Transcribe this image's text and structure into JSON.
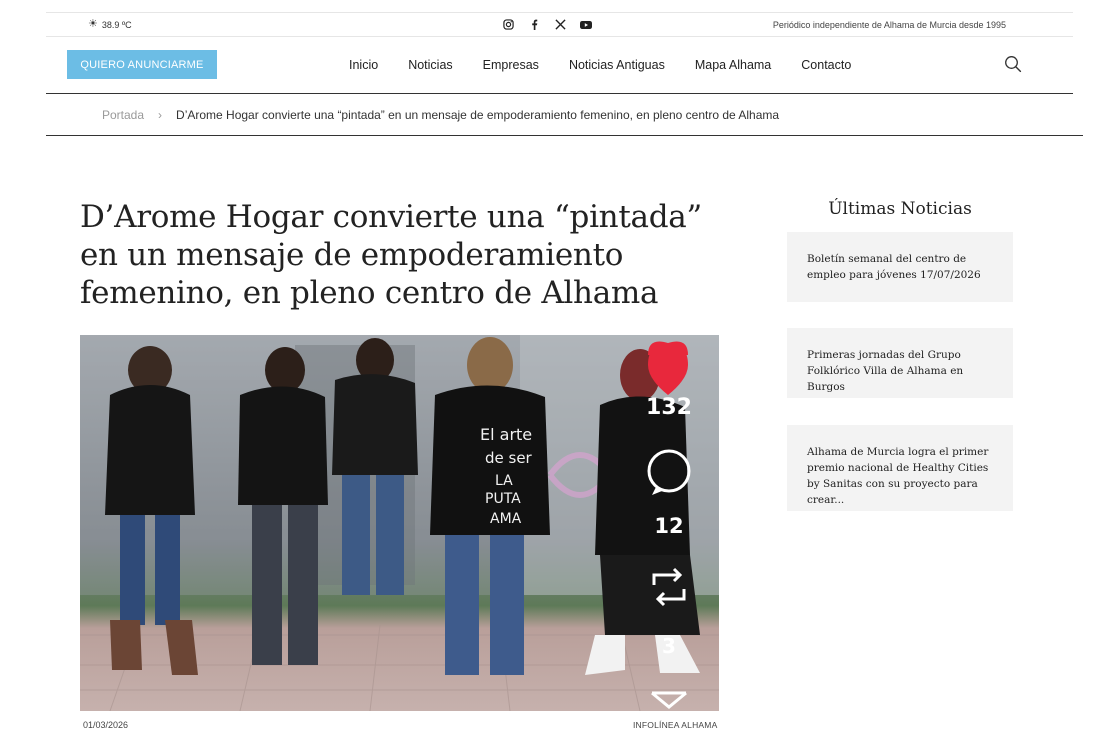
{
  "topbar": {
    "temperature": "38.9 ºC",
    "tagline": "Periódico independiente de Alhama de Murcia desde 1995",
    "social_icons": [
      "instagram-icon",
      "facebook-icon",
      "x-icon",
      "youtube-icon"
    ]
  },
  "nav": {
    "ad_button": "QUIERO ANUNCIARME",
    "items": [
      "Inicio",
      "Noticias",
      "Empresas",
      "Noticias Antiguas",
      "Mapa Alhama",
      "Contacto"
    ]
  },
  "breadcrumb": {
    "home": "Portada",
    "separator": "›",
    "current": "D’Arome Hogar convierte una “pintada” en un mensaje de empoderamiento femenino, en pleno centro de Alhama"
  },
  "article": {
    "title": "D’Arome Hogar convierte una “pintada” en un mensaje de empoderamiento femenino, en pleno centro de Alhama",
    "date": "01/03/2026",
    "author": "INFOLÍNEA ALHAMA",
    "image_overlay": {
      "likes": "132",
      "comments": "12",
      "reposts": "3",
      "jacket_text_1": "El arte de ser LA PUTA AMA",
      "jacket_text_2": "El arte de ser LA PUTA AMA"
    }
  },
  "sidebar": {
    "title": "Últimas Noticias",
    "items": [
      "Boletín semanal del centro de empleo para jóvenes 17/07/2026",
      "Primeras jornadas del Grupo Folklórico Villa de Alhama en Burgos",
      "Alhama de Murcia logra el primer premio nacional de Healthy Cities by Sanitas con su proyecto para crear..."
    ]
  },
  "colors": {
    "accent": "#6cbde5",
    "heart": "#e8283c",
    "card_bg": "#f3f3f3"
  }
}
